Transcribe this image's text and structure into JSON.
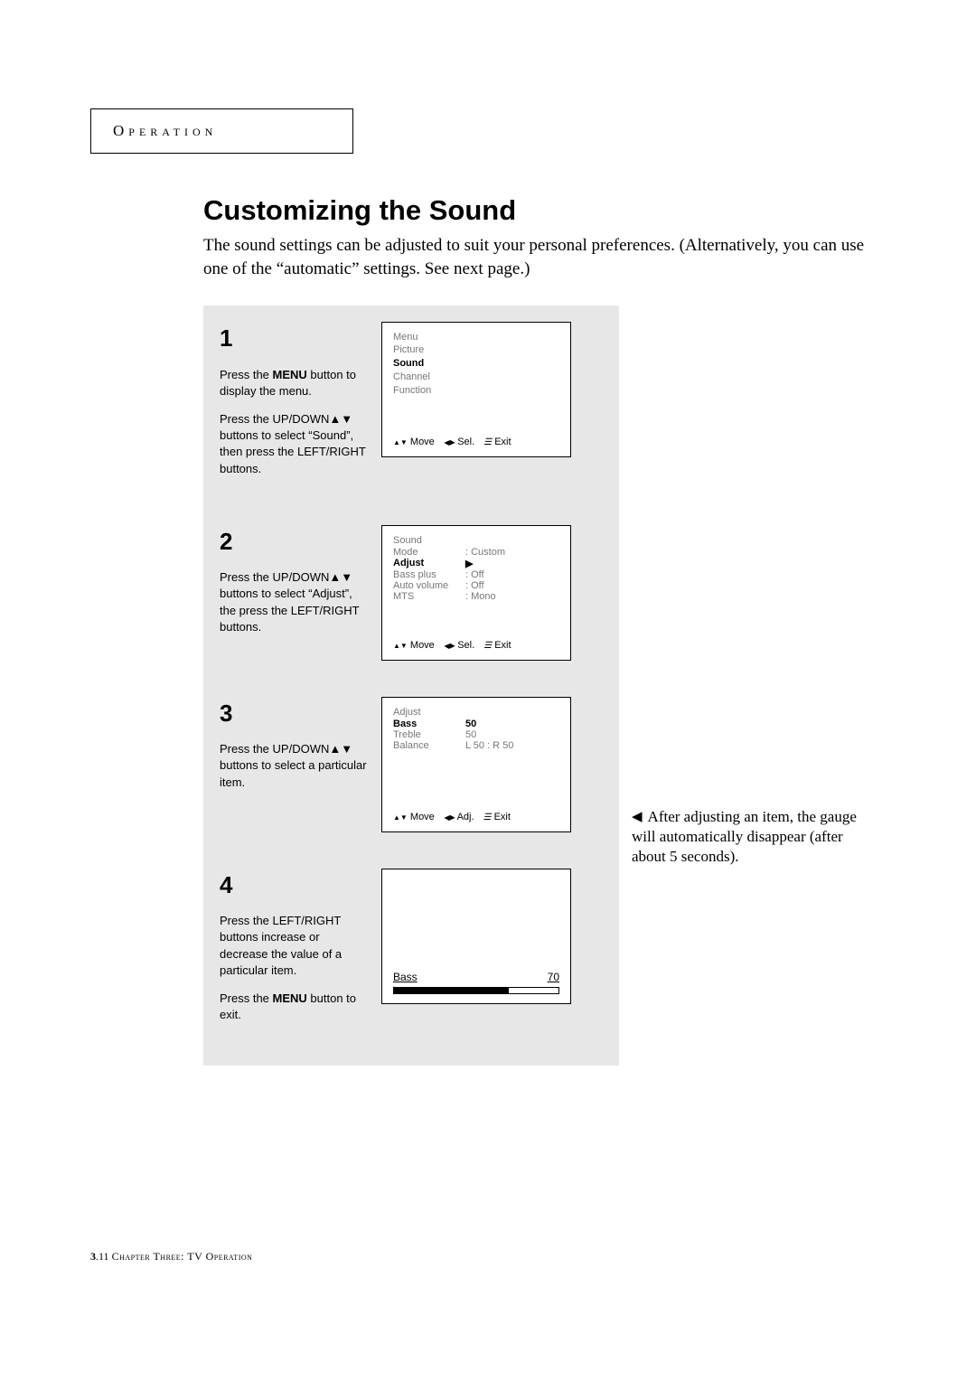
{
  "header_label": "Operation",
  "title": "Customizing the Sound",
  "intro": "The sound settings can be adjusted to suit your personal preferences. (Alternatively, you can use one of the “automatic” settings. See next page.)",
  "steps": {
    "s1": {
      "num": "1",
      "p1a": "Press the ",
      "p1b": "MENU",
      "p1c": " button to display the menu.",
      "p2": "Press the UP/DOWN▲▼ buttons to select “Sound”, then press the LEFT/RIGHT buttons.",
      "osd": {
        "title": "Menu",
        "items": [
          "Picture",
          "Sound",
          "Channel",
          "Function"
        ],
        "selected": "Sound",
        "foot_move": "Move",
        "foot_sel": "Sel.",
        "foot_exit": "Exit"
      }
    },
    "s2": {
      "num": "2",
      "p1": "Press the UP/DOWN▲▼ buttons to select “Adjust”, the press the LEFT/RIGHT buttons.",
      "osd": {
        "title": "Sound",
        "rows": [
          {
            "k": "Mode",
            "v": ": Custom"
          },
          {
            "k": "Adjust",
            "v": "▶",
            "sel": true
          },
          {
            "k": "Bass plus",
            "v": ": Off"
          },
          {
            "k": "Auto volume",
            "v": ": Off"
          },
          {
            "k": "MTS",
            "v": ": Mono"
          }
        ],
        "foot_move": "Move",
        "foot_sel": "Sel.",
        "foot_exit": "Exit"
      }
    },
    "s3": {
      "num": "3",
      "p1": "Press the UP/DOWN▲▼ buttons to select a particular item.",
      "osd": {
        "title": "Adjust",
        "rows": [
          {
            "k": "Bass",
            "v": "50",
            "sel": true
          },
          {
            "k": "Treble",
            "v": "50"
          },
          {
            "k": "Balance",
            "v": "L  50 : R  50"
          }
        ],
        "foot_move": "Move",
        "foot_adj": "Adj.",
        "foot_exit": "Exit"
      }
    },
    "s4": {
      "num": "4",
      "p1": "Press the LEFT/RIGHT buttons increase or decrease the value of a particular item.",
      "p2a": "Press the ",
      "p2b": "MENU",
      "p2c": " button to exit.",
      "osd": {
        "label": "Bass",
        "value": "70",
        "pct": 70
      }
    }
  },
  "side_note": "After adjusting an item, the gauge will automatically disappear (after about 5 seconds).",
  "footer": {
    "chapter": "3",
    "page": ".11",
    "text": " Chapter Three: TV Operation"
  }
}
